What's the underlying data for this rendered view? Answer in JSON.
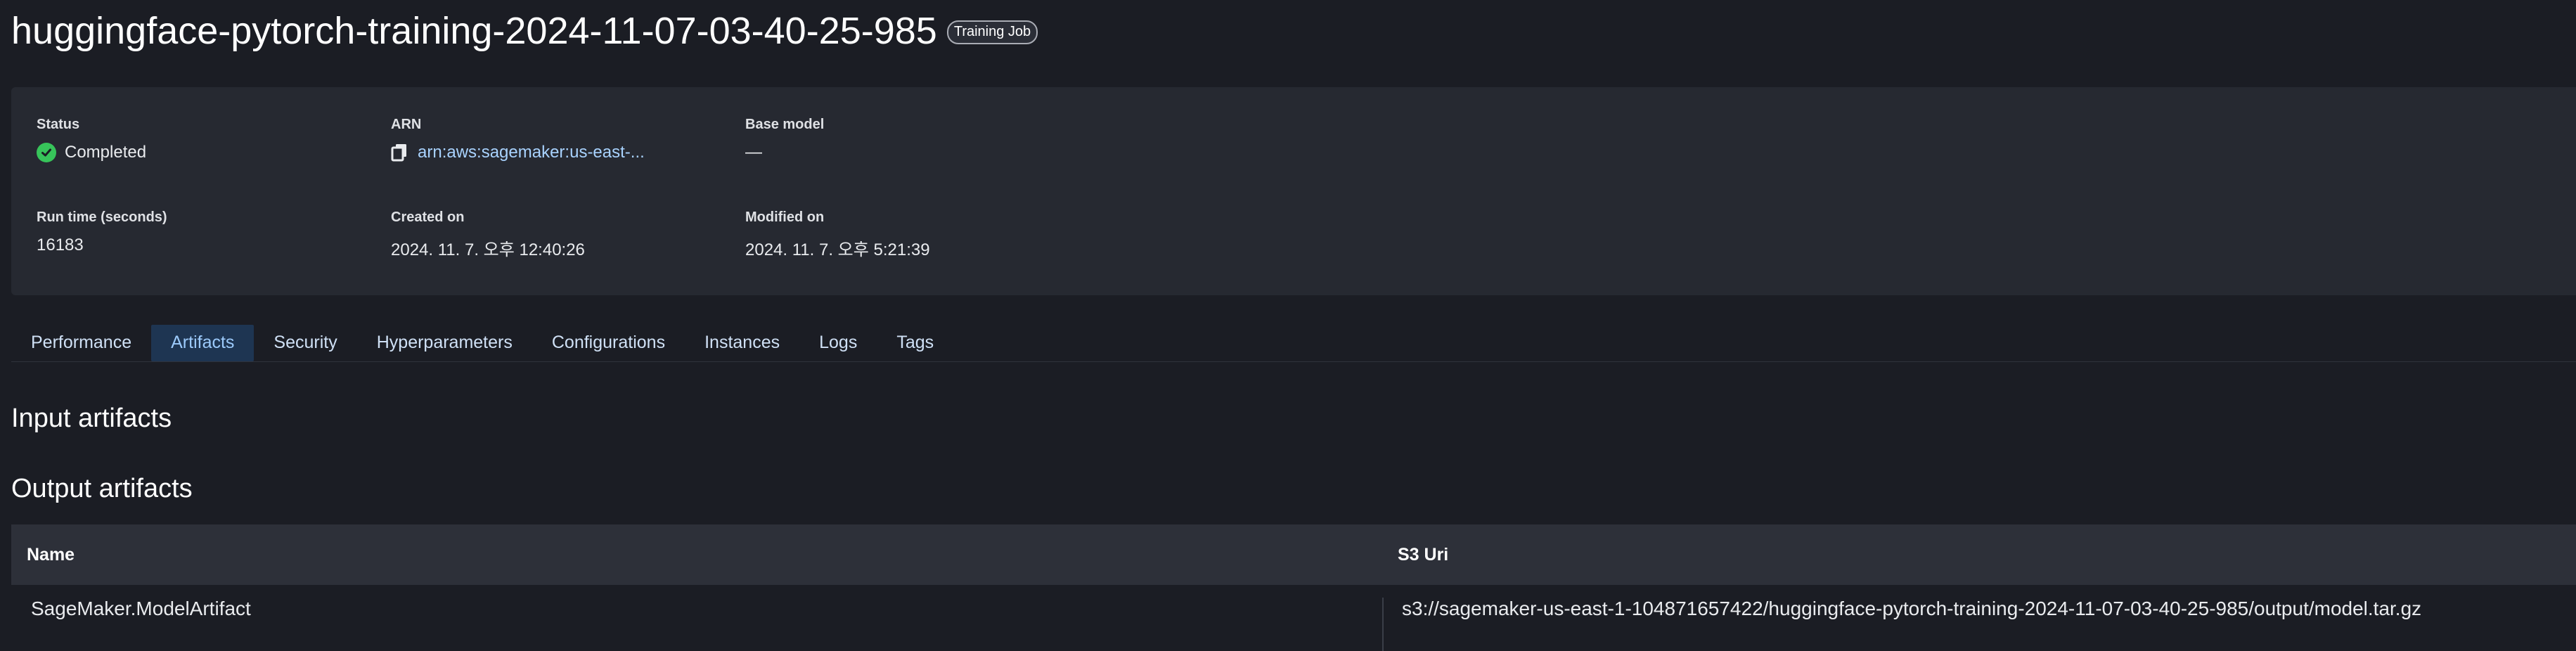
{
  "header": {
    "title": "huggingface-pytorch-training-2024-11-07-03-40-25-985",
    "badge": "Training Job"
  },
  "summary": {
    "status": {
      "label": "Status",
      "value": "Completed",
      "icon": "check-circle-icon",
      "color": "#37c45a"
    },
    "arn": {
      "label": "ARN",
      "value": "arn:aws:sagemaker:us-east-...",
      "icon": "copy-icon"
    },
    "base_model": {
      "label": "Base model",
      "value": "—"
    },
    "run_time": {
      "label": "Run time (seconds)",
      "value": "16183"
    },
    "created_on": {
      "label": "Created on",
      "value": "2024. 11. 7. 오후 12:40:26"
    },
    "modified_on": {
      "label": "Modified on",
      "value": "2024. 11. 7. 오후 5:21:39"
    }
  },
  "tabs": [
    {
      "label": "Performance",
      "active": false
    },
    {
      "label": "Artifacts",
      "active": true
    },
    {
      "label": "Security",
      "active": false
    },
    {
      "label": "Hyperparameters",
      "active": false
    },
    {
      "label": "Configurations",
      "active": false
    },
    {
      "label": "Instances",
      "active": false
    },
    {
      "label": "Logs",
      "active": false
    },
    {
      "label": "Tags",
      "active": false
    }
  ],
  "sections": {
    "input_title": "Input artifacts",
    "output_title": "Output artifacts"
  },
  "output_table": {
    "columns": [
      "Name",
      "S3 Uri"
    ],
    "rows": [
      [
        "SageMaker.ModelArtifact",
        "s3://sagemaker-us-east-1-104871657422/huggingface-pytorch-training-2024-11-07-03-40-25-985/output/model.tar.gz"
      ]
    ]
  },
  "colors": {
    "background": "#1b1d24",
    "panel": "#262931",
    "active_tab_bg": "#1e3552",
    "active_tab_text": "#9ccafb",
    "link": "#a9d3ff"
  }
}
